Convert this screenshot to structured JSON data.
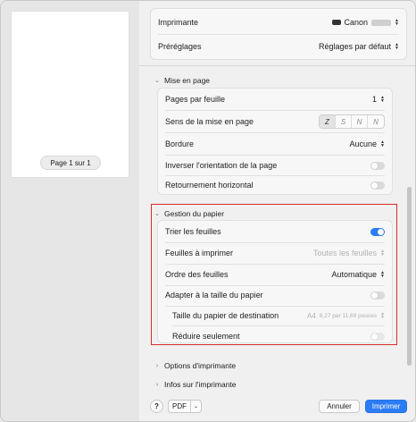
{
  "preview": {
    "page_label": "Page 1 sur 1"
  },
  "printer": {
    "label": "Imprimante",
    "value": "Canon"
  },
  "presets": {
    "label": "Préréglages",
    "value": "Réglages par défaut"
  },
  "layout": {
    "title": "Mise en page",
    "pages_per_sheet": {
      "label": "Pages par feuille",
      "value": "1"
    },
    "direction": {
      "label": "Sens de la mise en page",
      "options": [
        "Z",
        "S",
        "N",
        "N"
      ]
    },
    "border": {
      "label": "Bordure",
      "value": "Aucune"
    },
    "reverse": {
      "label": "Inverser l'orientation de la page"
    },
    "flip": {
      "label": "Retournement horizontal"
    }
  },
  "paper": {
    "title": "Gestion du papier",
    "collate": {
      "label": "Trier les feuilles"
    },
    "pages_to_print": {
      "label": "Feuilles à imprimer",
      "value": "Toutes les feuilles"
    },
    "page_order": {
      "label": "Ordre des feuilles",
      "value": "Automatique"
    },
    "scale_to_fit": {
      "label": "Adapter à la taille du papier"
    },
    "destination": {
      "label": "Taille du papier de destination",
      "size": "A4",
      "dims": "8,27 par 11,69 pouces"
    },
    "scale_down": {
      "label": "Réduire seulement"
    }
  },
  "collapsed": {
    "printer_options": "Options d'imprimante",
    "printer_info": "Infos sur l'imprimante"
  },
  "footer": {
    "help": "?",
    "pdf": "PDF",
    "cancel": "Annuler",
    "print": "Imprimer"
  },
  "colors": {
    "accent": "#2b7cf5",
    "highlight": "#d92b2b"
  }
}
